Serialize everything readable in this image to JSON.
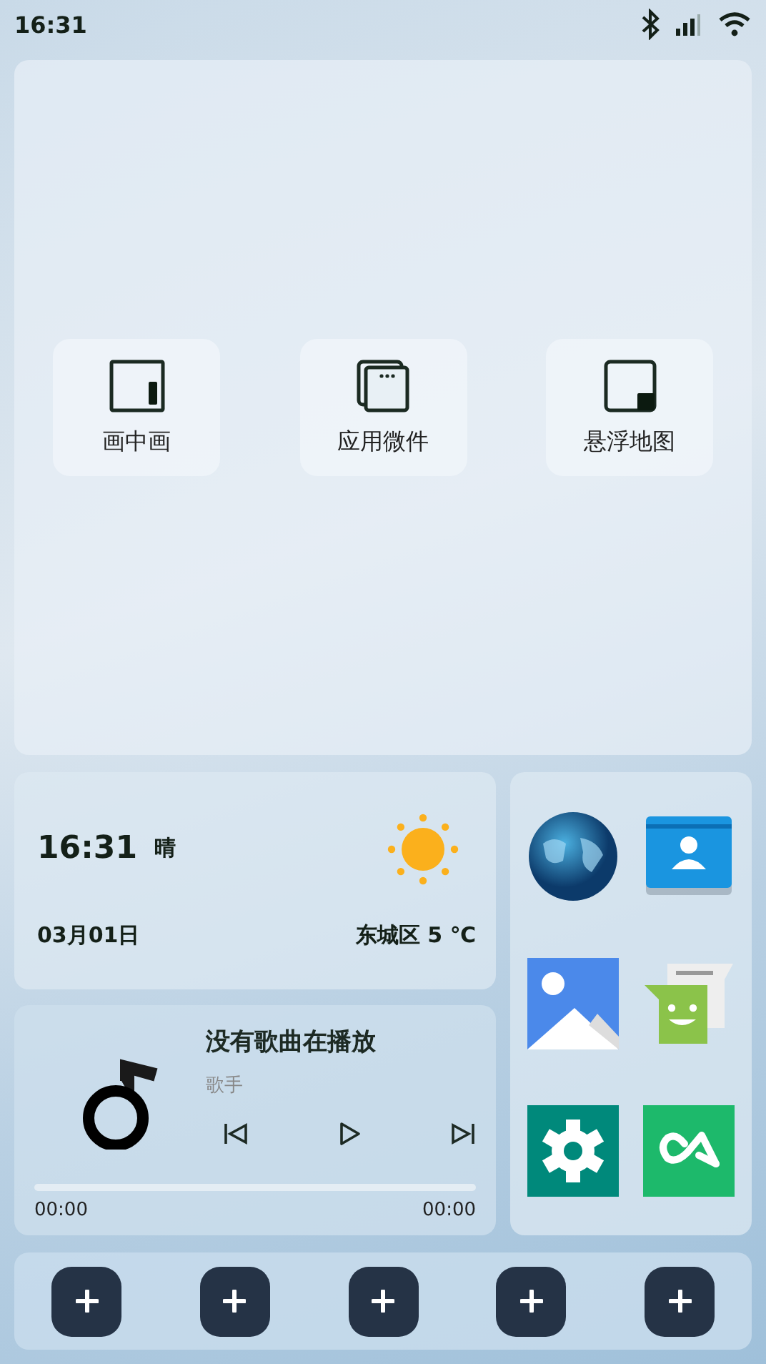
{
  "status_bar": {
    "time": "16:31"
  },
  "shortcuts": [
    {
      "kind": "pip",
      "label": "画中画"
    },
    {
      "kind": "widgets",
      "label": "应用微件"
    },
    {
      "kind": "float",
      "label": "悬浮地图"
    }
  ],
  "weather": {
    "time": "16:31",
    "condition": "晴",
    "date": "03月01日",
    "location_temp": "东城区 5 ℃"
  },
  "music": {
    "title": "没有歌曲在播放",
    "artist": "歌手",
    "progress": {
      "level": 0
    },
    "elapsed": "00:00",
    "total": "00:00"
  }
}
